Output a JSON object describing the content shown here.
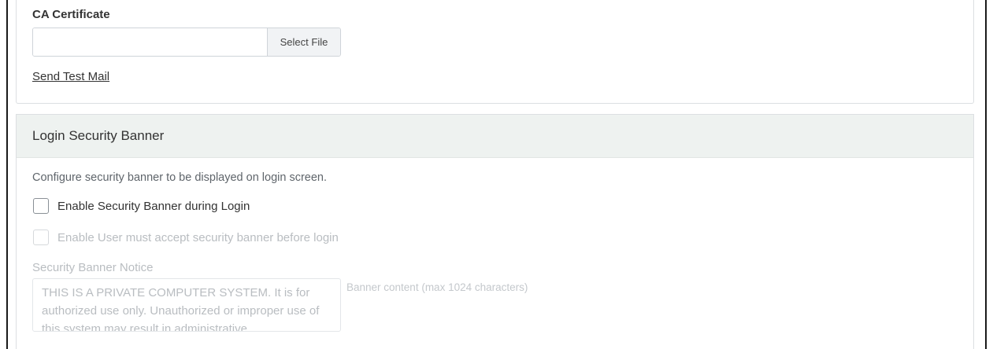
{
  "smtp": {
    "ca_certificate_label": "CA Certificate",
    "file_input_value": "",
    "select_file_label": "Select File",
    "send_test_mail_label": "Send Test Mail"
  },
  "login_banner": {
    "title": "Login Security Banner",
    "description": "Configure security banner to be displayed on login screen.",
    "enable_banner_label": "Enable Security Banner during Login",
    "enable_banner_checked": false,
    "enable_accept_label": "Enable User must accept security banner before login",
    "enable_accept_checked": false,
    "enable_accept_disabled": true,
    "notice_label": "Security Banner Notice",
    "notice_text": "THIS IS A PRIVATE COMPUTER SYSTEM. It is for authorized use only. Unauthorized or improper use of this system may result in administrative",
    "notice_hint": "Banner content (max 1024 characters)"
  }
}
